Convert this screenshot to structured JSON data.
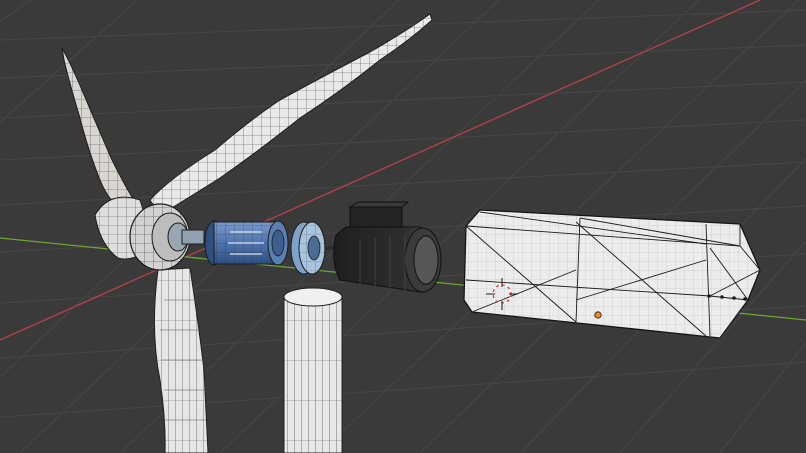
{
  "app": {
    "name": "3D Viewport",
    "view": "perspective",
    "shading": "wireframe-overlay"
  },
  "scene": {
    "objects": [
      {
        "name": "rotor-blades",
        "kind": "mesh"
      },
      {
        "name": "rotor-hub",
        "kind": "mesh"
      },
      {
        "name": "gear-coupling",
        "kind": "mesh"
      },
      {
        "name": "bearing-disc",
        "kind": "mesh"
      },
      {
        "name": "generator-motor",
        "kind": "mesh"
      },
      {
        "name": "nacelle-housing",
        "kind": "mesh"
      },
      {
        "name": "tower-pole",
        "kind": "mesh"
      },
      {
        "name": "tower-cylinder",
        "kind": "mesh"
      }
    ],
    "origin_marker": "object-origin-dot",
    "cursor": "3d-cursor"
  },
  "colors": {
    "background": "#3a3a3a",
    "grid": "#4a4a4a",
    "x_axis": "#b5414e",
    "y_axis": "#6fa533",
    "mesh_fill": "#e8e8e8",
    "wire": "#1c1c1c",
    "blue_part": "#5a7fb5",
    "motor": "#2c2c2c",
    "origin": "#f08a1c",
    "cursor_red": "#e23a3a"
  }
}
